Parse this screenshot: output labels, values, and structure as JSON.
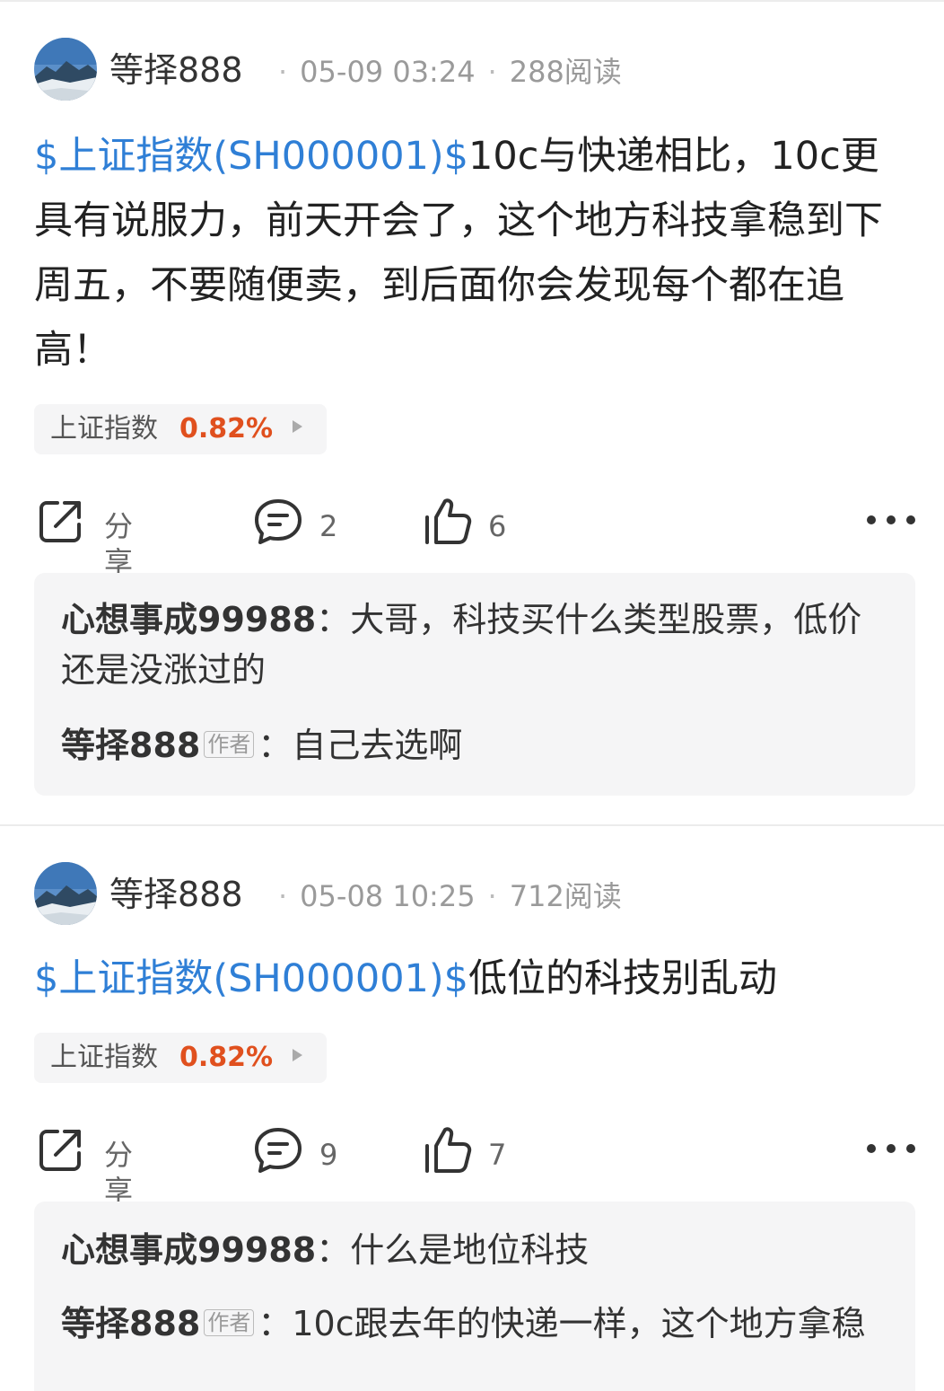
{
  "posts": [
    {
      "author": "等择888",
      "time": "05-09 03:24",
      "reads": "288阅读",
      "stock_link": "$上证指数(SH000001)$",
      "text": "10c与快递相比，10c更具有说服力，前天开会了，这个地方科技拿稳到下周五，不要随便卖，到后面你会发现每个都在追高！",
      "tag": {
        "name": "上证指数",
        "change": "0.82%"
      },
      "actions": {
        "share": "分享",
        "comments": "2",
        "likes": "6"
      },
      "replies": [
        {
          "user": "心想事成99988",
          "is_author": false,
          "sep": "：",
          "text": "大哥，科技买什么类型股票，低价还是没涨过的"
        },
        {
          "user": "等择888",
          "is_author": true,
          "badge": "作者",
          "sep": "：",
          "text": "自己去选啊"
        }
      ]
    },
    {
      "author": "等择888",
      "time": "05-08 10:25",
      "reads": "712阅读",
      "stock_link": "$上证指数(SH000001)$",
      "text": "低位的科技别乱动",
      "tag": {
        "name": "上证指数",
        "change": "0.82%"
      },
      "actions": {
        "share": "分享",
        "comments": "9",
        "likes": "7"
      },
      "replies": [
        {
          "user": "心想事成99988",
          "is_author": false,
          "sep": "：",
          "text": "什么是地位科技"
        },
        {
          "user": "等择888",
          "is_author": true,
          "badge": "作者",
          "sep": "：",
          "text": "10c跟去年的快递一样，这个地方拿稳"
        }
      ]
    }
  ],
  "colors": {
    "link": "#2f7fd6",
    "up": "#e0501e",
    "panel": "#f5f5f6"
  },
  "icons": [
    "share-icon",
    "comment-icon",
    "like-icon",
    "more-icon"
  ]
}
